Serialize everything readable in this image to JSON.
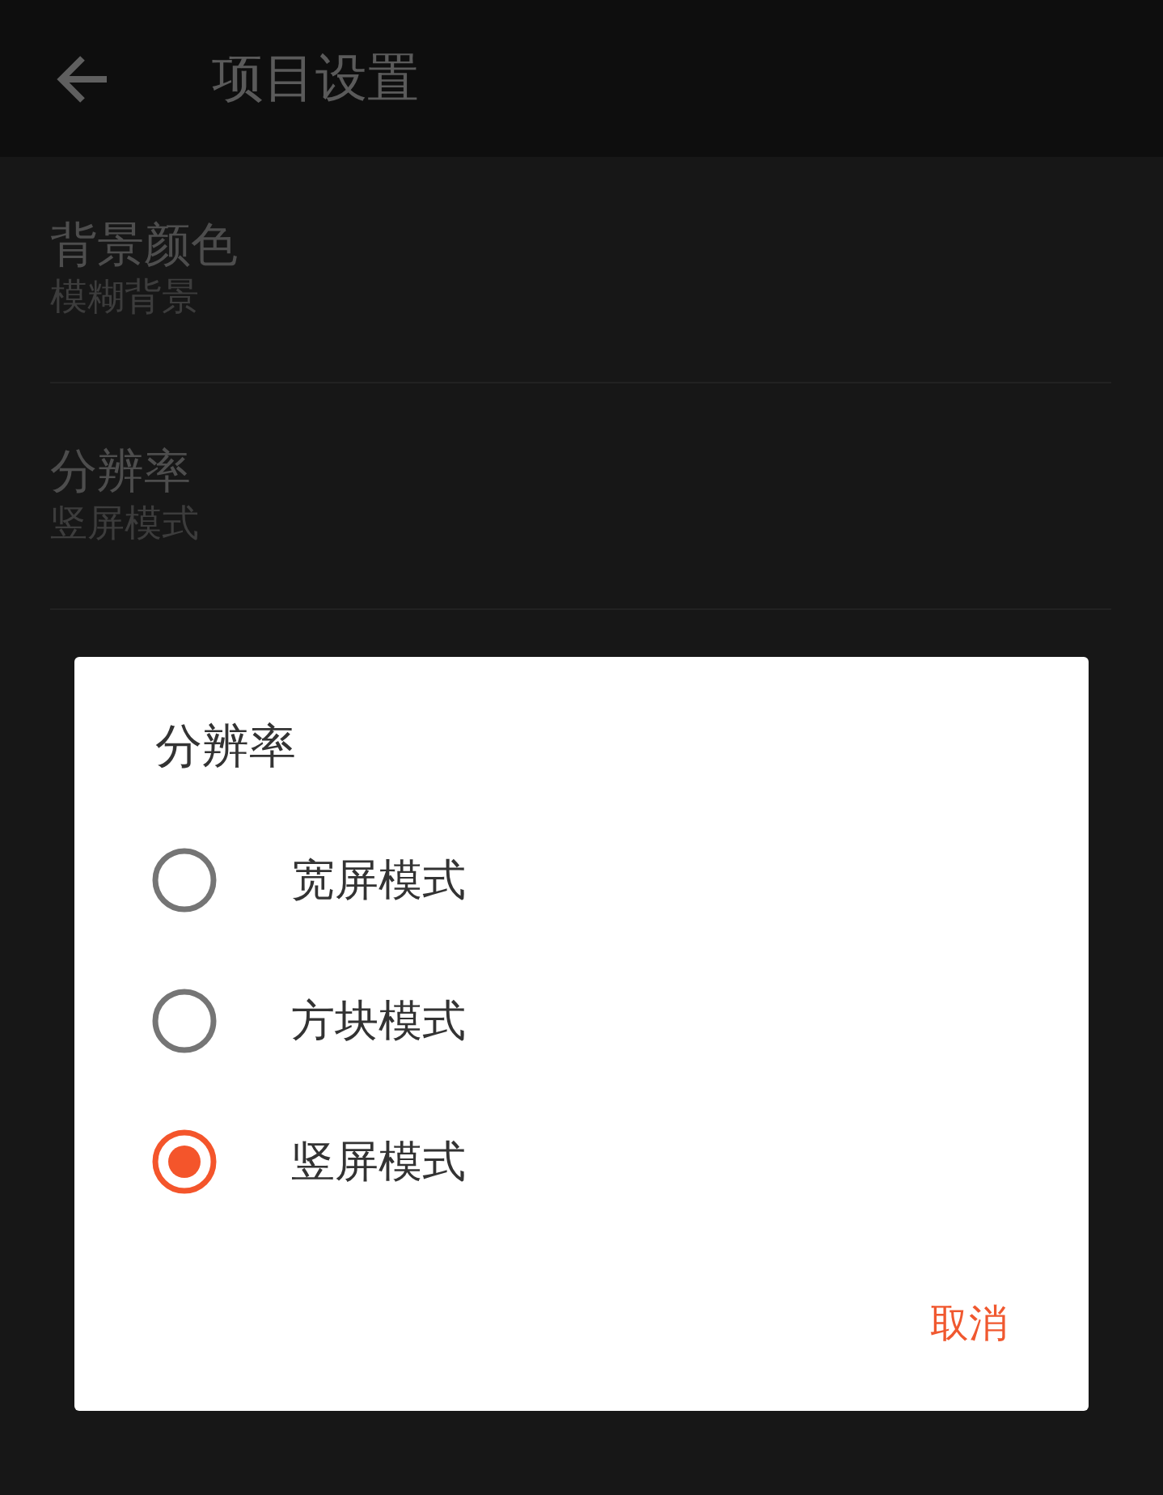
{
  "app_bar": {
    "title": "项目设置"
  },
  "settings": [
    {
      "title": "背景颜色",
      "value": "模糊背景"
    },
    {
      "title": "分辨率",
      "value": "竖屏模式"
    }
  ],
  "dialog": {
    "title": "分辨率",
    "options": [
      {
        "label": "宽屏模式",
        "selected": false
      },
      {
        "label": "方块模式",
        "selected": false
      },
      {
        "label": "竖屏模式",
        "selected": true
      }
    ],
    "buttons": [
      "取消"
    ]
  }
}
